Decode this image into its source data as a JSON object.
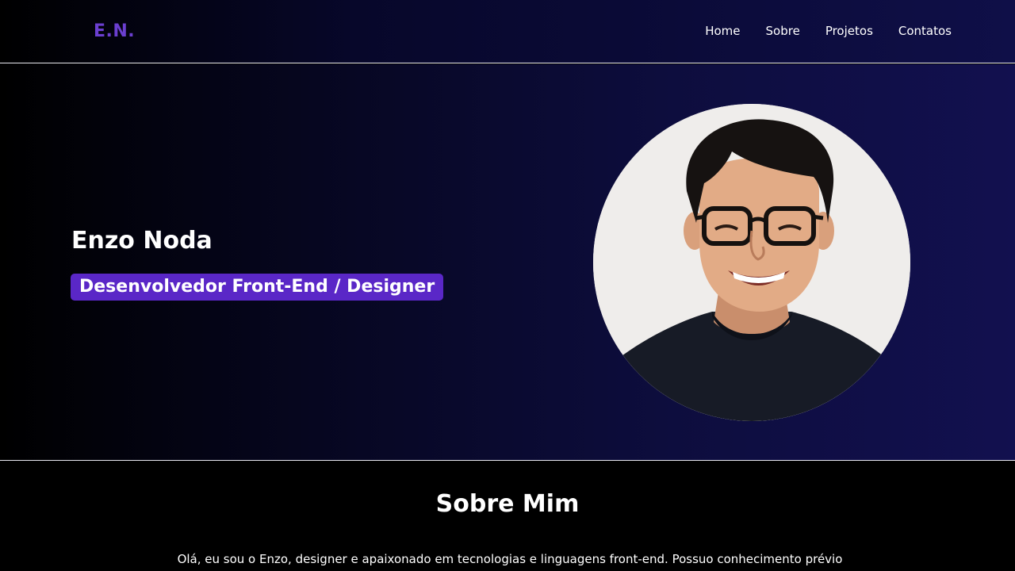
{
  "navbar": {
    "logo": "E.N.",
    "links": [
      "Home",
      "Sobre",
      "Projetos",
      "Contatos"
    ]
  },
  "hero": {
    "name": "Enzo Noda",
    "role": "Desenvolvedor Front-End / Designer"
  },
  "about": {
    "title": "Sobre Mim",
    "text": "Olá, eu sou o Enzo, designer e apaixonado em tecnologias e linguagens front-end. Possuo conhecimento prévio"
  },
  "colors": {
    "accent": "#5a27c7",
    "logo": "#6b3fd0",
    "navy": "#12104f"
  }
}
